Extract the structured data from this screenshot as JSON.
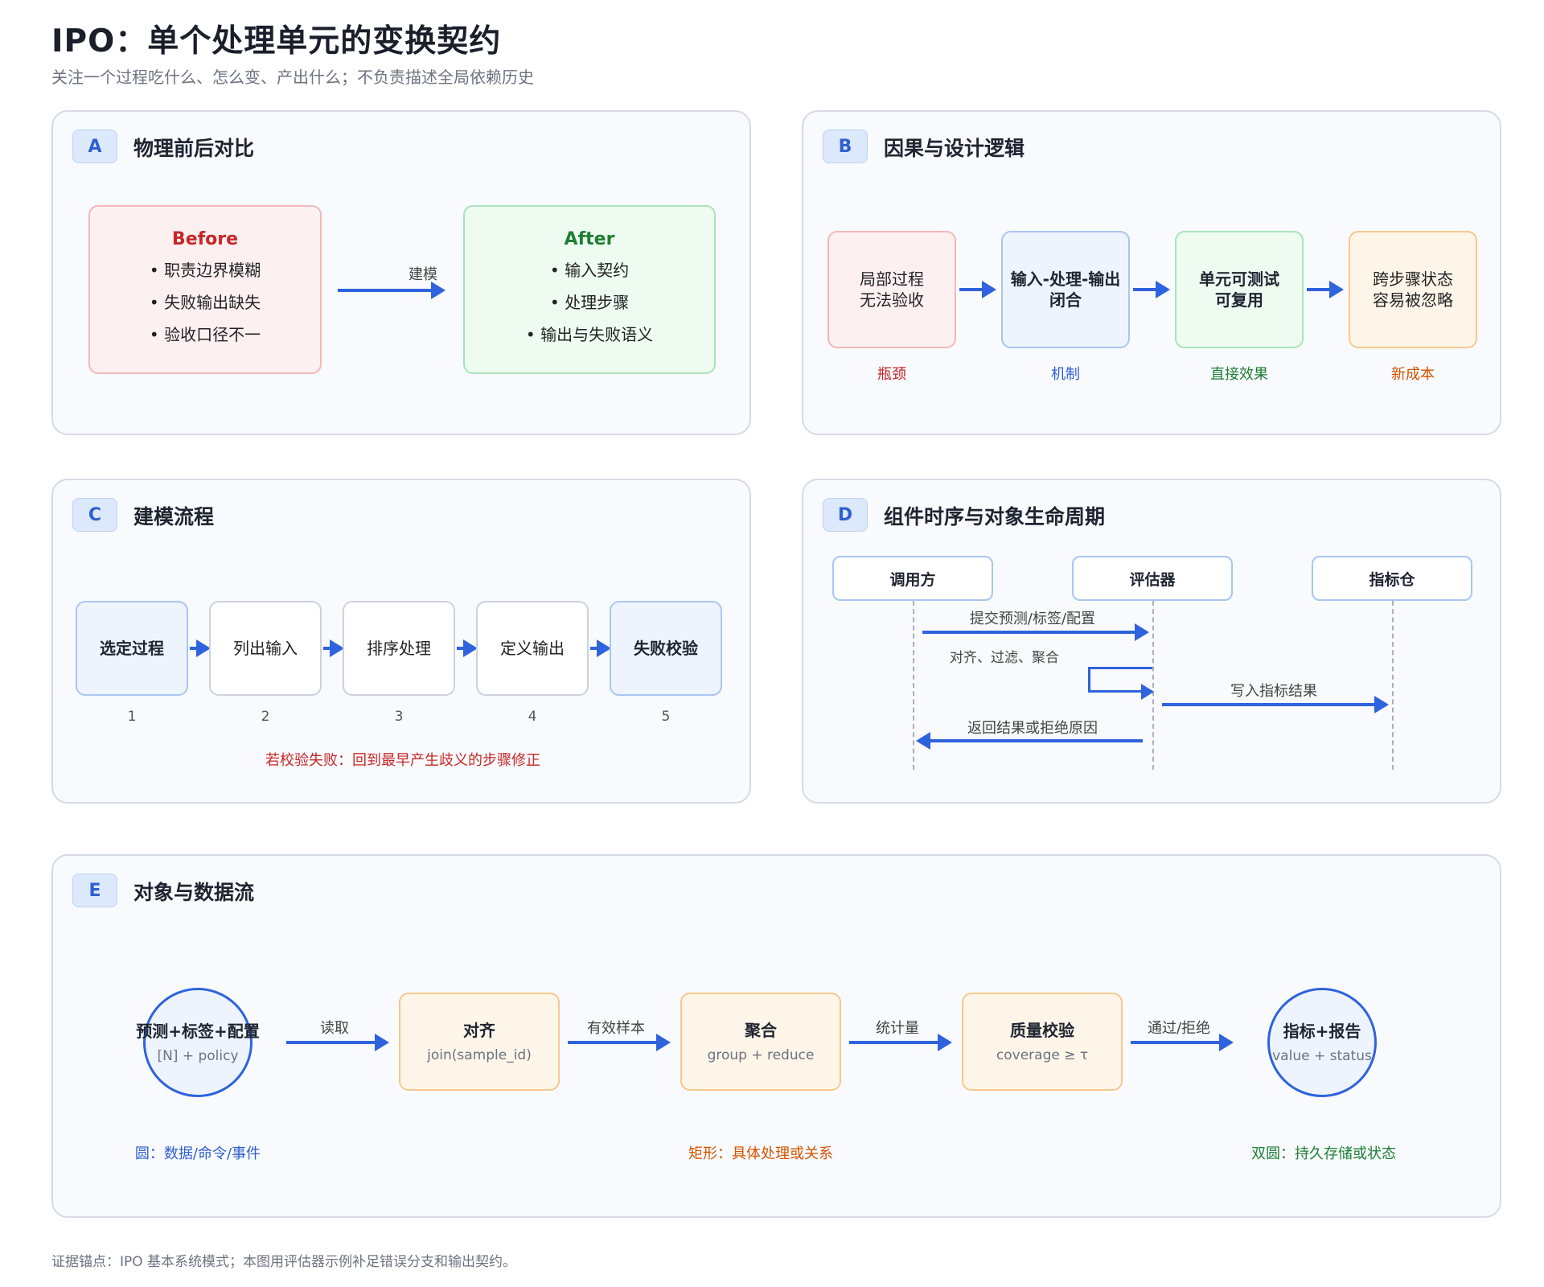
{
  "header": {
    "title": "IPO：单个处理单元的变换契约",
    "subtitle": "关注一个过程吃什么、怎么变、产出什么；不负责描述全局依赖历史"
  },
  "panel_a": {
    "badge": "A",
    "title": "物理前后对比",
    "before": {
      "title": "Before",
      "items": [
        "• 职责边界模糊",
        "• 失败输出缺失",
        "• 验收口径不一"
      ]
    },
    "arrow_label": "建模",
    "after": {
      "title": "After",
      "items": [
        "• 输入契约",
        "• 处理步骤",
        "• 输出与失败语义"
      ]
    }
  },
  "panel_b": {
    "badge": "B",
    "title": "因果与设计逻辑",
    "steps": [
      {
        "text": "局部过程\n无法验收",
        "caption": "瓶颈"
      },
      {
        "text": "输入-处理-输出\n闭合",
        "caption": "机制"
      },
      {
        "text": "单元可测试\n可复用",
        "caption": "直接效果"
      },
      {
        "text": "跨步骤状态\n容易被忽略",
        "caption": "新成本"
      }
    ]
  },
  "panel_c": {
    "badge": "C",
    "title": "建模流程",
    "steps": [
      {
        "label": "选定过程",
        "num": "1"
      },
      {
        "label": "列出输入",
        "num": "2"
      },
      {
        "label": "排序处理",
        "num": "3"
      },
      {
        "label": "定义输出",
        "num": "4"
      },
      {
        "label": "失败校验",
        "num": "5"
      }
    ],
    "note": "若校验失败：回到最早产生歧义的步骤修正"
  },
  "panel_d": {
    "badge": "D",
    "title": "组件时序与对象生命周期",
    "actors": [
      "调用方",
      "评估器",
      "指标仓"
    ],
    "messages": [
      "提交预测/标签/配置",
      "对齐、过滤、聚合",
      "写入指标结果",
      "返回结果或拒绝原因"
    ]
  },
  "panel_e": {
    "badge": "E",
    "title": "对象与数据流",
    "nodes": [
      {
        "title": "预测+标签+配置",
        "sub": "[N] + policy"
      },
      {
        "title": "对齐",
        "sub": "join(sample_id)"
      },
      {
        "title": "聚合",
        "sub": "group + reduce"
      },
      {
        "title": "质量校验",
        "sub": "coverage ≥ τ"
      },
      {
        "title": "指标+报告",
        "sub": "value + status"
      }
    ],
    "edges": [
      "读取",
      "有效样本",
      "统计量",
      "通过/拒绝"
    ],
    "legend": [
      "圆：数据/命令/事件",
      "矩形：具体处理或关系",
      "双圆：持久存储或状态"
    ]
  },
  "footer": "证据锚点：IPO 基本系统模式；本图用评估器示例补足错误分支和输出契约。",
  "colors": {
    "accent": "#2e63dd",
    "red_text": "#c62828",
    "green_text": "#1e7e34",
    "blue_text": "#2f5fd0",
    "orange_text": "#d35400"
  }
}
